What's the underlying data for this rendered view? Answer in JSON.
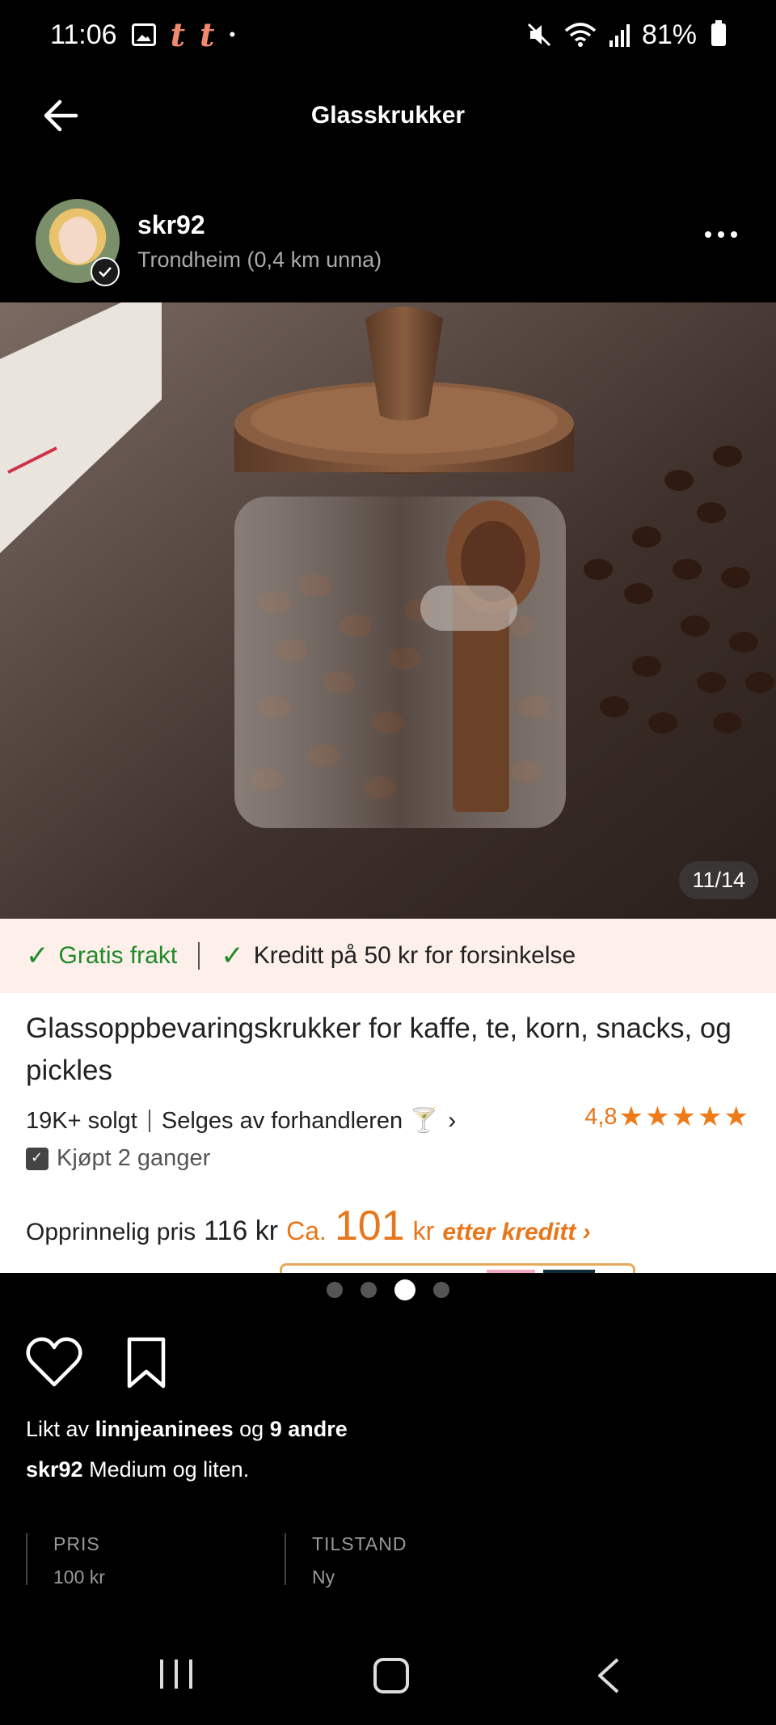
{
  "status_bar": {
    "time": "11:06",
    "notification_icons": [
      "image-icon",
      "t-icon",
      "t-icon"
    ],
    "notification_t": "t",
    "dot": "•",
    "battery": "81%",
    "icons": [
      "mute-icon",
      "wifi-icon",
      "signal-icon",
      "battery-icon"
    ]
  },
  "header": {
    "title": "Glasskrukker",
    "back_icon": "arrow-left-icon"
  },
  "seller": {
    "name": "skr92",
    "location": "Trondheim (0,4 km unna)",
    "more_icon": "more-dots-icon"
  },
  "product": {
    "image_counter": "11/14",
    "banner": {
      "free_shipping": "Gratis frakt",
      "credit": "Kreditt på 50 kr for forsinkelse"
    },
    "title": "Glassoppbevaringskrukker for kaffe, te, korn, snacks, og pickles",
    "sold": "19K+ solgt",
    "sold_by": "Selges av forhandleren 🍸",
    "chevron": "›",
    "rating": "4,8",
    "stars": 5,
    "bought": "Kjøpt 2 ganger",
    "price_label": "Opprinnelig pris",
    "orig_price": "116 kr",
    "ca": "Ca.",
    "price_after": "101",
    "kr": "kr",
    "after_credit": "etter kreditt ›",
    "accent_color": "#e8761b",
    "green_color": "#1f8a2a"
  },
  "pager": {
    "count": 4,
    "active": 3
  },
  "post": {
    "liked_by_prefix": "Likt av",
    "liked_by_user": "linnjeaninees",
    "liked_by_mid": "og",
    "liked_by_others": "9 andre",
    "caption_user": "skr92",
    "caption_text": "Medium og liten."
  },
  "info": {
    "price_label": "PRIS",
    "price_value": "100 kr",
    "condition_label": "TILSTAND",
    "condition_value": "Ny"
  },
  "nav": {
    "icons": [
      "recent-apps-icon",
      "home-icon",
      "back-icon"
    ]
  }
}
